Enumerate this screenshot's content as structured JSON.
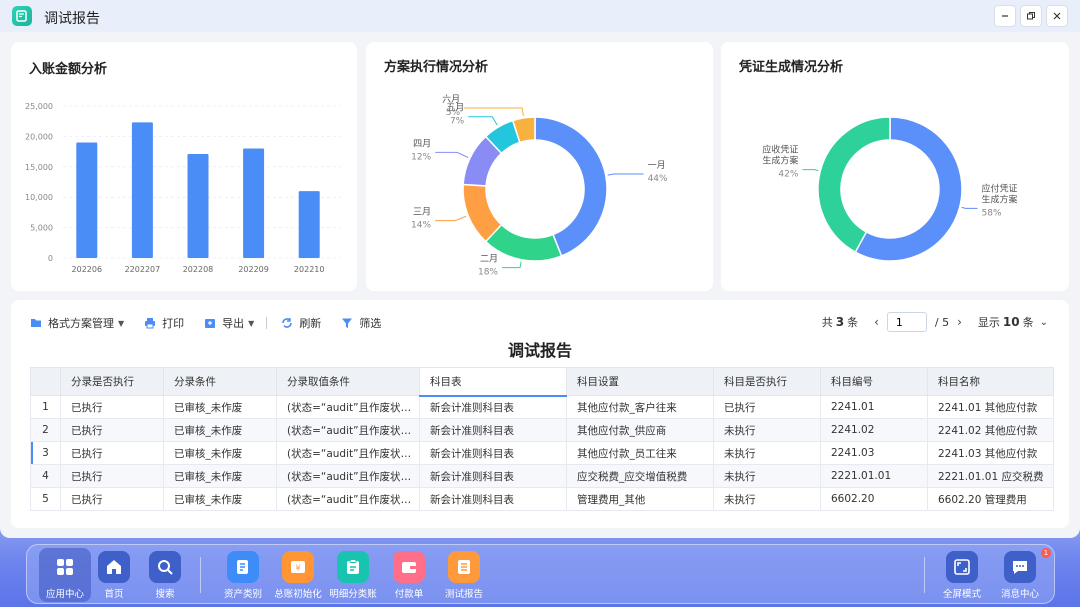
{
  "window": {
    "title": "调试报告"
  },
  "charts": {
    "revenue_title": "入账金额分析",
    "plan_title": "方案执行情况分析",
    "voucher_title": "凭证生成情况分析"
  },
  "chart_data": [
    {
      "type": "bar",
      "title": "入账金额分析",
      "categories": [
        "202206",
        "2202207",
        "202208",
        "202209",
        "202210"
      ],
      "values": [
        19000,
        22300,
        17100,
        18000,
        11000
      ],
      "ylim": [
        0,
        25000
      ],
      "yticks": [
        "0",
        "5,000",
        "10,000",
        "15,000",
        "20,000",
        "25,000"
      ],
      "grid": true,
      "color": "#4a8df6"
    },
    {
      "type": "pie",
      "title": "方案执行情况分析",
      "donut": true,
      "labels": [
        "一月",
        "二月",
        "三月",
        "四月",
        "五月",
        "六月"
      ],
      "values": [
        44,
        18,
        14,
        12,
        7,
        5
      ],
      "value_labels": [
        "44%",
        "18%",
        "14%",
        "12%",
        "7%",
        "5%"
      ],
      "colors": [
        "#5b8ff9",
        "#2fd48a",
        "#ff9f43",
        "#8a8cf5",
        "#23c6dc",
        "#f8b13f"
      ]
    },
    {
      "type": "pie",
      "title": "凭证生成情况分析",
      "donut": true,
      "labels": [
        "应付凭证\n生成方案",
        "应收凭证\n生成方案"
      ],
      "values": [
        58,
        42
      ],
      "value_labels": [
        "58%",
        "42%"
      ],
      "colors": [
        "#5b8ff9",
        "#2fd19b"
      ]
    }
  ],
  "toolbar": {
    "format_label": "格式方案管理",
    "print_label": "打印",
    "export_label": "导出",
    "refresh_label": "刷新",
    "filter_label": "筛选"
  },
  "pager": {
    "total_prefix": "共",
    "total_count": "3",
    "total_suffix": "条",
    "current_page": "1",
    "total_pages": "/  5",
    "size_prefix": "显示",
    "page_size": "10",
    "size_suffix": "条"
  },
  "report": {
    "heading": "调试报告"
  },
  "table": {
    "columns": [
      "",
      "分录是否执行",
      "分录条件",
      "分录取值条件",
      "科目表",
      "科目设置",
      "科目是否执行",
      "科目编号",
      "科目名称"
    ],
    "rows": [
      [
        "1",
        "已执行",
        "已审核_未作废",
        "(状态=“audit”且作废状态...",
        "新会计准则科目表",
        "其他应付款_客户往来",
        "已执行",
        "2241.01",
        "2241.01 其他应付款"
      ],
      [
        "2",
        "已执行",
        "已审核_未作废",
        "(状态=“audit”且作废状态...",
        "新会计准则科目表",
        "其他应付款_供应商",
        "未执行",
        "2241.02",
        "2241.02 其他应付款"
      ],
      [
        "3",
        "已执行",
        "已审核_未作废",
        "(状态=“audit”且作废状态...",
        "新会计准则科目表",
        "其他应付款_员工往来",
        "未执行",
        "2241.03",
        "2241.03 其他应付款"
      ],
      [
        "4",
        "已执行",
        "已审核_未作废",
        "(状态=“audit”且作废状态...",
        "新会计准则科目表",
        "应交税费_应交增值税费",
        "未执行",
        "2221.01.01",
        "2221.01.01 应交税费"
      ],
      [
        "5",
        "已执行",
        "已审核_未作废",
        "(状态=“audit”且作废状态...",
        "新会计准则科目表",
        "管理费用_其他",
        "未执行",
        "6602.20",
        "6602.20 管理费用"
      ]
    ]
  },
  "dock": {
    "items": [
      {
        "label": "应用中心"
      },
      {
        "label": "首页"
      },
      {
        "label": "搜索"
      },
      {
        "label": "资产类别"
      },
      {
        "label": "总账初始化"
      },
      {
        "label": "明细分类账"
      },
      {
        "label": "付款单"
      },
      {
        "label": "测试报告"
      },
      {
        "label": "全屏模式"
      },
      {
        "label": "消息中心"
      }
    ],
    "badge": "1"
  }
}
